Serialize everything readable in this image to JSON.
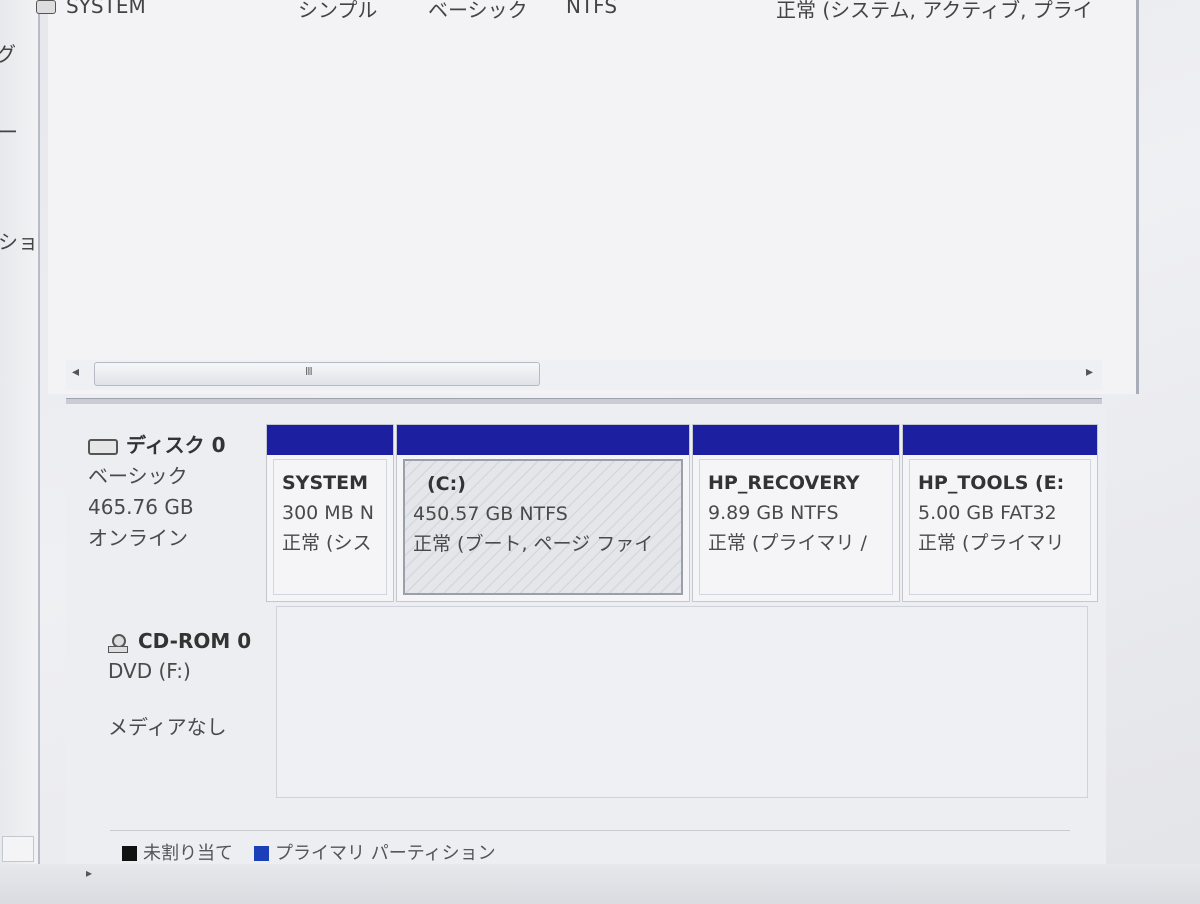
{
  "leftnav": {
    "items": [
      "グ",
      "ー",
      "ショ"
    ]
  },
  "volume_list": {
    "rows": [
      {
        "name": "SYSTEM",
        "layout": "シンプル",
        "type": "ベーシック",
        "fs": "NTFS",
        "status": "正常 (システム, アクティブ, プライ"
      }
    ]
  },
  "scrollbar": {
    "left_arrow": "◂",
    "right_arrow": "▸",
    "grip": "III"
  },
  "disk0": {
    "name": "ディスク 0",
    "type": "ベーシック",
    "size": "465.76 GB",
    "status": "オンライン"
  },
  "partitions": [
    {
      "name": "SYSTEM",
      "size": "300 MB N",
      "status": "正常 (シス"
    },
    {
      "name": "(C:)",
      "size": "450.57 GB NTFS",
      "status": "正常 (ブート, ページ ファイ"
    },
    {
      "name": "HP_RECOVERY",
      "size": "9.89 GB NTFS",
      "status": "正常 (プライマリ /"
    },
    {
      "name": "HP_TOOLS (E:",
      "size": "5.00 GB FAT32",
      "status": "正常 (プライマリ"
    }
  ],
  "cdrom": {
    "name": "CD-ROM 0",
    "drive": "DVD (F:)",
    "status": "メディアなし"
  },
  "legend": [
    {
      "label": "未割り当て",
      "color": "#111111"
    },
    {
      "label": "プライマリ パーティション",
      "color": "#1b3fb8"
    }
  ],
  "colors": {
    "partition_bar": "#1b1fa0"
  }
}
